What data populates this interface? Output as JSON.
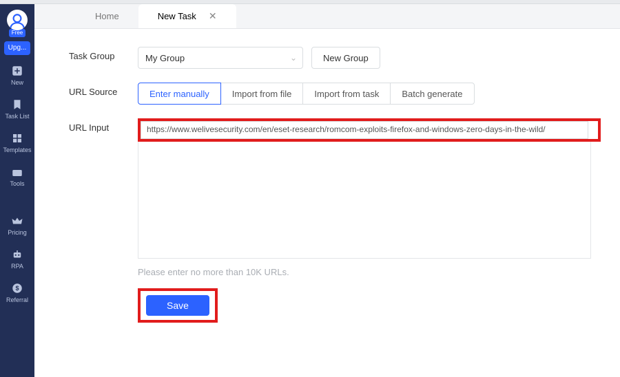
{
  "sidebar": {
    "free_label": "Free",
    "upgrade_label": "Upg...",
    "items": [
      {
        "label": "New"
      },
      {
        "label": "Task List"
      },
      {
        "label": "Templates"
      },
      {
        "label": "Tools"
      },
      {
        "label": "Pricing"
      },
      {
        "label": "RPA"
      },
      {
        "label": "Referral"
      }
    ]
  },
  "tabs": {
    "home": "Home",
    "new_task": "New Task",
    "close_glyph": "✕"
  },
  "form": {
    "task_group_label": "Task Group",
    "task_group_value": "My Group",
    "new_group_label": "New Group",
    "url_source_label": "URL Source",
    "source_options": {
      "enter_manually": "Enter manually",
      "import_file": "Import from file",
      "import_task": "Import from task",
      "batch_generate": "Batch generate"
    },
    "url_input_label": "URL Input",
    "url_value": "https://www.welivesecurity.com/en/eset-research/romcom-exploits-firefox-and-windows-zero-days-in-the-wild/",
    "hint": "Please enter no more than 10K URLs.",
    "save_label": "Save"
  }
}
